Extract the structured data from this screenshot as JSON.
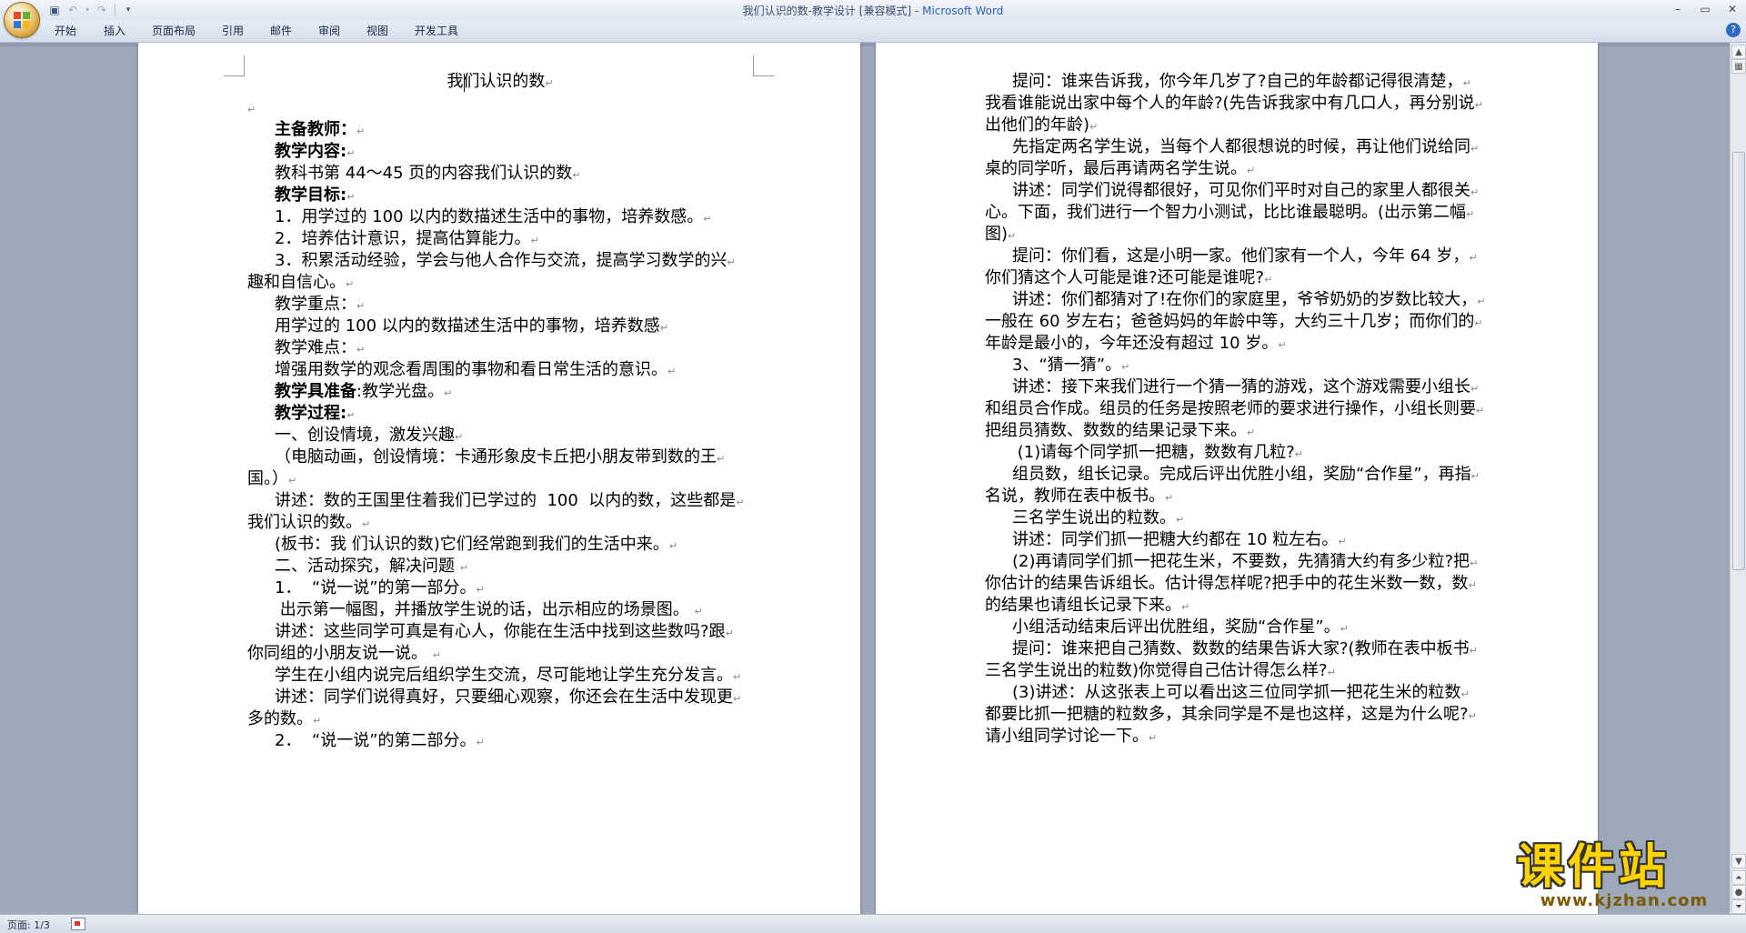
{
  "window": {
    "title_doc": "我们认识的数-教学设计 [兼容模式] - ",
    "title_app": "Microsoft Word"
  },
  "ribbon_tabs": [
    "开始",
    "插入",
    "页面布局",
    "引用",
    "邮件",
    "审阅",
    "视图",
    "开发工具"
  ],
  "page1": {
    "title": "我们认识的数",
    "lines": [
      {
        "text": "",
        "bold": false,
        "indent": 0
      },
      {
        "text": "主备教师：",
        "bold": true,
        "indent": 1
      },
      {
        "text": "教学内容:",
        "bold": true,
        "indent": 1
      },
      {
        "text": "教科书第 44～45 页的内容我们认识的数",
        "bold": false,
        "indent": 1
      },
      {
        "text": "教学目标:",
        "bold": true,
        "indent": 1
      },
      {
        "text": "1．用学过的 100 以内的数描述生活中的事物，培养数感。",
        "bold": false,
        "indent": 1
      },
      {
        "text": "2．培养估计意识，提高估算能力。",
        "bold": false,
        "indent": 1
      },
      {
        "text": "3．积累活动经验，学会与他人合作与交流，提高学习数学的兴",
        "bold": false,
        "indent": 1
      },
      {
        "text": "趣和自信心。",
        "bold": false,
        "indent": 0
      },
      {
        "text": "教学重点：",
        "bold": false,
        "indent": 1
      },
      {
        "text": "用学过的 100 以内的数描述生活中的事物，培养数感",
        "bold": false,
        "indent": 1
      },
      {
        "text": "教学难点：",
        "bold": false,
        "indent": 1
      },
      {
        "text": "增强用数学的观念看周围的事物和看日常生活的意识。",
        "bold": false,
        "indent": 1
      },
      {
        "text": "教学具准备:教学光盘。",
        "bold": false,
        "indent": 1,
        "bold_prefix": "教学具准备"
      },
      {
        "text": "教学过程:",
        "bold": true,
        "indent": 1
      },
      {
        "text": "一、创设情境，激发兴趣",
        "bold": false,
        "indent": 1
      },
      {
        "text": "（电脑动画，创设情境：卡通形象皮卡丘把小朋友带到数的王",
        "bold": false,
        "indent": 1
      },
      {
        "text": "国。）",
        "bold": false,
        "indent": 0
      },
      {
        "text": "讲述：数的王国里住着我们已学过的  100  以内的数，这些都是",
        "bold": false,
        "indent": 1
      },
      {
        "text": "我们认识的数。",
        "bold": false,
        "indent": 0
      },
      {
        "text": "(板书：我 们认识的数)它们经常跑到我们的生活中来。",
        "bold": false,
        "indent": 1
      },
      {
        "text": "二、活动探究，解决问题 ",
        "bold": false,
        "indent": 1
      },
      {
        "text": "1．  “说一说”的第一部分。",
        "bold": false,
        "indent": 1
      },
      {
        "text": " 出示第一幅图，并播放学生说的话，出示相应的场景图。 ",
        "bold": false,
        "indent": 1
      },
      {
        "text": "讲述：这些同学可真是有心人，你能在生活中找到这些数吗?跟",
        "bold": false,
        "indent": 1
      },
      {
        "text": "你同组的小朋友说一说。 ",
        "bold": false,
        "indent": 0
      },
      {
        "text": "学生在小组内说完后组织学生交流，尽可能地让学生充分发言。",
        "bold": false,
        "indent": 1
      },
      {
        "text": "讲述：同学们说得真好，只要细心观察，你还会在生活中发现更",
        "bold": false,
        "indent": 1
      },
      {
        "text": "多的数。",
        "bold": false,
        "indent": 0
      },
      {
        "text": "2．  “说一说”的第二部分。",
        "bold": false,
        "indent": 1
      }
    ]
  },
  "page2": {
    "lines": [
      {
        "text": "提问：谁来告诉我，你今年几岁了?自己的年龄都记得很清楚，",
        "indent": 1
      },
      {
        "text": "我看谁能说出家中每个人的年龄?(先告诉我家中有几口人，再分别说",
        "indent": 0
      },
      {
        "text": "出他们的年龄)",
        "indent": 0
      },
      {
        "text": "先指定两名学生说，当每个人都很想说的时候，再让他们说给同",
        "indent": 1
      },
      {
        "text": "桌的同学听，最后再请两名学生说。",
        "indent": 0
      },
      {
        "text": "讲述：同学们说得都很好，可见你们平时对自己的家里人都很关",
        "indent": 1
      },
      {
        "text": "心。下面，我们进行一个智力小测试，比比谁最聪明。(出示第二幅",
        "indent": 0
      },
      {
        "text": "图)",
        "indent": 0
      },
      {
        "text": "提问：你们看，这是小明一家。他们家有一个人，今年 64 岁，",
        "indent": 1
      },
      {
        "text": "你们猜这个人可能是谁?还可能是谁呢?",
        "indent": 0
      },
      {
        "text": "讲述：你们都猜对了!在你们的家庭里，爷爷奶奶的岁数比较大，",
        "indent": 1
      },
      {
        "text": "一般在 60 岁左右；爸爸妈妈的年龄中等，大约三十几岁；而你们的",
        "indent": 0
      },
      {
        "text": "年龄是最小的，今年还没有超过 10 岁。",
        "indent": 0
      },
      {
        "text": "3、“猜一猜”。",
        "indent": 1
      },
      {
        "text": "讲述：接下来我们进行一个猜一猜的游戏，这个游戏需要小组长",
        "indent": 1
      },
      {
        "text": "和组员合作成。组员的任务是按照老师的要求进行操作，小组长则要",
        "indent": 0
      },
      {
        "text": "把组员猜数、数数的结果记录下来。",
        "indent": 0
      },
      {
        "text": " (1)请每个同学抓一把糖，数数有几粒?",
        "indent": 1
      },
      {
        "text": "组员数，组长记录。完成后评出优胜小组，奖励“合作星”，再指",
        "indent": 1
      },
      {
        "text": "名说，教师在表中板书。",
        "indent": 0
      },
      {
        "text": "三名学生说出的粒数。",
        "indent": 1
      },
      {
        "text": "讲述：同学们抓一把糖大约都在 10 粒左右。",
        "indent": 1
      },
      {
        "text": "(2)再请同学们抓一把花生米，不要数，先猜猜大约有多少粒?把",
        "indent": 1
      },
      {
        "text": "你估计的结果告诉组长。估计得怎样呢?把手中的花生米数一数，数",
        "indent": 0
      },
      {
        "text": "的结果也请组长记录下来。",
        "indent": 0
      },
      {
        "text": "小组活动结束后评出优胜组，奖励“合作星”。",
        "indent": 1
      },
      {
        "text": "提问：谁来把自己猜数、数数的结果告诉大家?(教师在表中板书",
        "indent": 1
      },
      {
        "text": "三名学生说出的粒数)你觉得自己估计得怎么样?",
        "indent": 0
      },
      {
        "text": "(3)讲述：从这张表上可以看出这三位同学抓一把花生米的粒数",
        "indent": 1
      },
      {
        "text": "都要比抓一把糖的粒数多，其余同学是不是也这样，这是为什么呢?",
        "indent": 0
      },
      {
        "text": "请小组同学讨论一下。",
        "indent": 0
      }
    ]
  },
  "status": {
    "page_indicator": "页面: 1/3"
  },
  "watermark": {
    "name": "课件站",
    "url": "www.kjzhan.com"
  }
}
